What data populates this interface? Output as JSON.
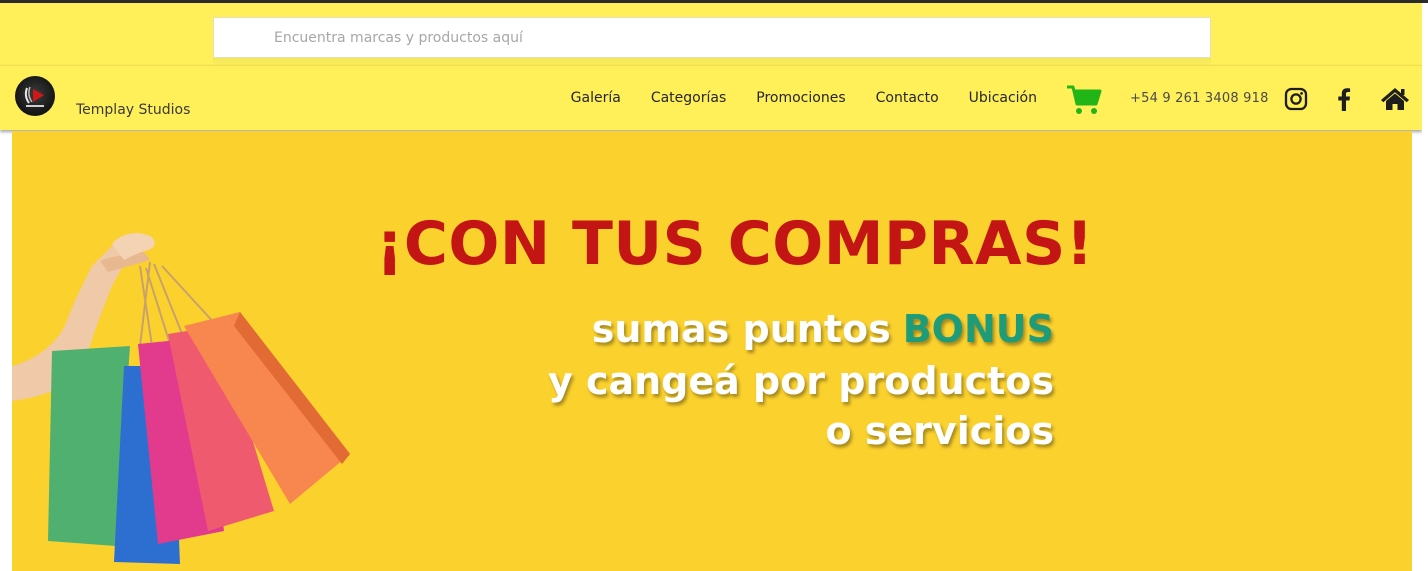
{
  "search": {
    "placeholder": "Encuentra marcas y productos aquí",
    "value": ""
  },
  "brand": {
    "name": "Templay Studios",
    "logo_icon": "templay-logo"
  },
  "nav": {
    "links": [
      "Galería",
      "Categorías",
      "Promociones",
      "Contacto",
      "Ubicación"
    ],
    "cart_icon": "shopping-cart-icon",
    "phone": "+54 9 261 3408 918",
    "social_icons": [
      "instagram-icon",
      "facebook-icon",
      "home-icon"
    ]
  },
  "banner": {
    "headline": "¡CON TUS COMPRAS!",
    "line1": "sumas puntos",
    "bonus": "BONUS",
    "line2": "y cangeá por productos",
    "line3": "o servicios",
    "image_icon": "shopping-bags-illustration"
  },
  "colors": {
    "band": "#fff05a",
    "banner_bg": "#fbd12e",
    "headline": "#c41515",
    "bonus": "#1e9c7a",
    "cart": "#22b518"
  }
}
